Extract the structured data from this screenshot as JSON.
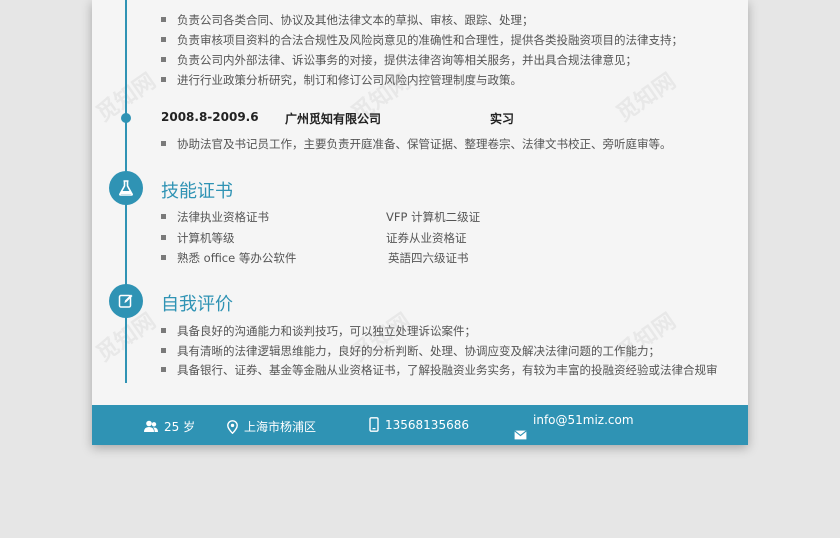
{
  "work": {
    "bullets_top": [
      "负责公司各类合同、协议及其他法律文本的草拟、审核、跟踪、处理；",
      "负责审核项目资料的合法合规性及风险岗意见的准确性和合理性，提供各类投融资项目的法律支持；",
      "负责公司内外部法律、诉讼事务的对接，提供法律咨询等相关服务，并出具合规法律意见；",
      "进行行业政策分析研究，制订和修订公司风险内控管理制度与政策。"
    ],
    "job2": {
      "period": "2008.8-2009.6",
      "company": "广州觅知有限公司",
      "role": "实习"
    },
    "job2_bullets": [
      "协助法官及书记员工作，主要负责开庭准备、保管证据、整理卷宗、法律文书校正、旁听庭审等。"
    ]
  },
  "skills": {
    "title": "技能证书",
    "col1": [
      "法律执业资格证书",
      "计算机等级",
      "熟悉 office 等办公软件"
    ],
    "col2": [
      "VFP 计算机二级证",
      "证券从业资格证",
      "英語四六级证书"
    ]
  },
  "self": {
    "title": "自我评价",
    "bullets": [
      "具备良好的沟通能力和谈判技巧，可以独立处理诉讼案件；",
      "具有清晰的法律逻辑思维能力，良好的分析判断、处理、协调应变及解决法律问题的工作能力；",
      "具备银行、证券、基金等金融从业资格证书，了解投融资业务实务，有较为丰富的投融资经验或法律合规审"
    ]
  },
  "footer": {
    "age": "25 岁",
    "location": "上海市杨浦区",
    "phone": "13568135686",
    "email": "info@51miz.com"
  },
  "watermark": "觅知网",
  "colors": {
    "accent": "#2f93b4",
    "text": "#555555",
    "page": "#f5f5f5"
  }
}
